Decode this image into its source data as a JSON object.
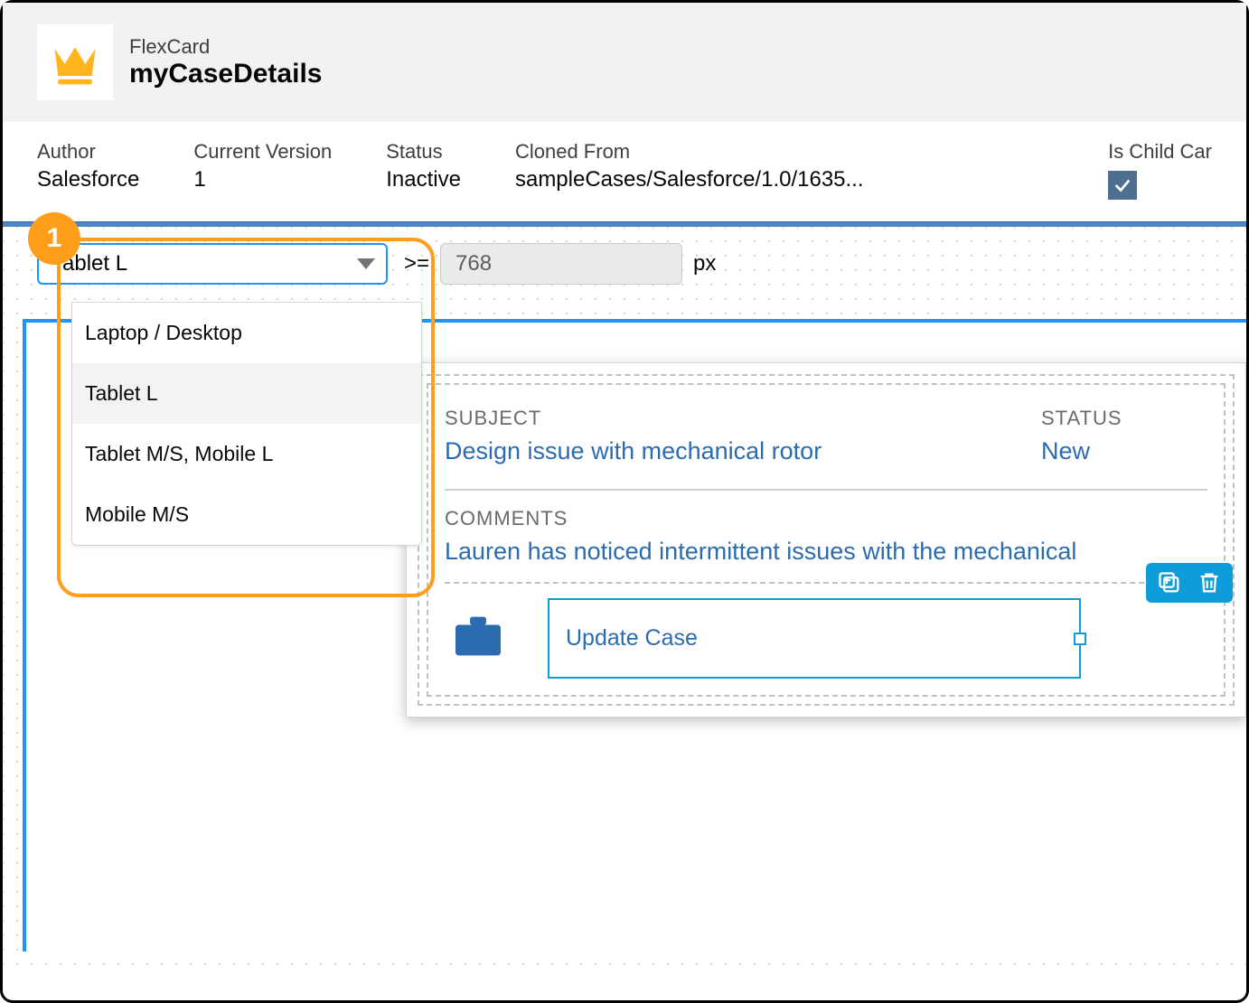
{
  "header": {
    "type_label": "FlexCard",
    "title": "myCaseDetails"
  },
  "meta": {
    "author_label": "Author",
    "author_value": "Salesforce",
    "version_label": "Current Version",
    "version_value": "1",
    "status_label": "Status",
    "status_value": "Inactive",
    "cloned_label": "Cloned From",
    "cloned_value": "sampleCases/Salesforce/1.0/1635...",
    "child_label": "Is Child Car"
  },
  "toolbar": {
    "device_selected": "Tablet L",
    "operator": ">=",
    "px_value": "768",
    "px_unit": "px",
    "options": [
      {
        "label": "Laptop / Desktop"
      },
      {
        "label": "Tablet L"
      },
      {
        "label": "Tablet M/S, Mobile L"
      },
      {
        "label": "Mobile M/S"
      }
    ]
  },
  "marker": "1",
  "card": {
    "subject_label": "SUBJECT",
    "subject_value": "Design issue with mechanical rotor",
    "status_label": "STATUS",
    "status_value": "New",
    "comments_label": "COMMENTS",
    "comments_value": "Lauren has noticed intermittent issues with the mechanical",
    "action_label": "Update Case"
  }
}
